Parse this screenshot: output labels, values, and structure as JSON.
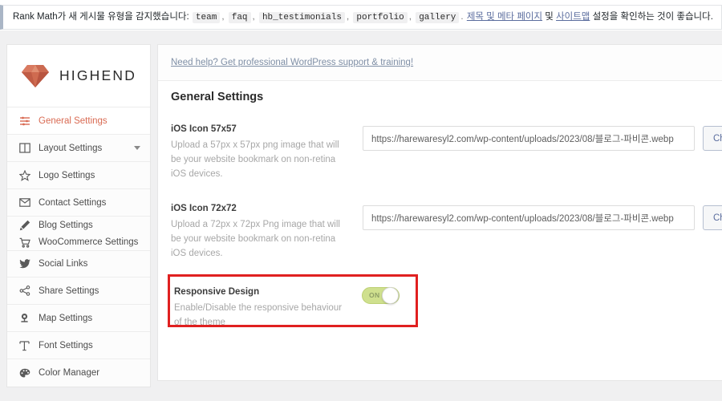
{
  "notice": {
    "lead": "Rank Math가 새 게시물 유형을 감지했습니다:",
    "chips": [
      "team",
      "faq",
      "hb_testimonials",
      "portfolio",
      "gallery"
    ],
    "mid": ".",
    "link1": "제목 및 메타 페이지",
    "conj": "및",
    "link2": "사이트맵",
    "tail": "설정을 확인하는 것이 좋습니다.",
    "link_color": "#5b6d9e"
  },
  "sidebar": {
    "logo_text": "HIGHEND",
    "logo_icon": "diamond-gem-icon",
    "logo_color": "#d4694f",
    "active_color": "#d96a52",
    "items": [
      {
        "label": "General Settings",
        "icon": "sliders-icon",
        "active": true,
        "caret": false
      },
      {
        "label": "Layout Settings",
        "icon": "columns-icon",
        "active": false,
        "caret": true
      },
      {
        "label": "Logo Settings",
        "icon": "star-icon",
        "active": false,
        "caret": false
      },
      {
        "label": "Contact Settings",
        "icon": "envelope-icon",
        "active": false,
        "caret": false
      },
      {
        "label": "Blog Settings",
        "icon": "pencil-icon",
        "active": false,
        "caret": false
      },
      {
        "label": "WooCommerce Settings",
        "icon": "cart-icon",
        "active": false,
        "caret": false
      },
      {
        "label": "Social Links",
        "icon": "twitter-bird-icon",
        "active": false,
        "caret": false
      },
      {
        "label": "Share Settings",
        "icon": "share-icon",
        "active": false,
        "caret": false
      },
      {
        "label": "Map Settings",
        "icon": "map-pin-icon",
        "active": false,
        "caret": false
      },
      {
        "label": "Font Settings",
        "icon": "text-format-icon",
        "active": false,
        "caret": false
      },
      {
        "label": "Color Manager",
        "icon": "palette-icon",
        "active": false,
        "caret": false
      }
    ]
  },
  "content": {
    "help_text": "Need help? Get professional WordPress support & training!",
    "section_title": "General Settings",
    "fields": [
      {
        "label": "iOS Icon 57x57",
        "description": "Upload a 57px x 57px png image that will be your website bookmark on non-retina iOS devices.",
        "value": "https://harewaresyl2.com/wp-content/uploads/2023/08/블로그-파비콘.webp",
        "placeholder": "",
        "button_label": "Choose"
      },
      {
        "label": "iOS Icon 72x72",
        "description": "Upload a 72px x 72px Png image that will be your website bookmark on non-retina iOS devices.",
        "value": "https://harewaresyl2.com/wp-content/uploads/2023/08/블로그-파비콘.webp",
        "placeholder": "",
        "button_label": "Choose"
      }
    ],
    "responsive": {
      "label": "Responsive Design",
      "description": "Enable/Disable the responsive behaviour of the theme",
      "toggle_state": "ON",
      "toggle_on_color": "#cfe08e",
      "highlight_color": "#e02020"
    }
  }
}
